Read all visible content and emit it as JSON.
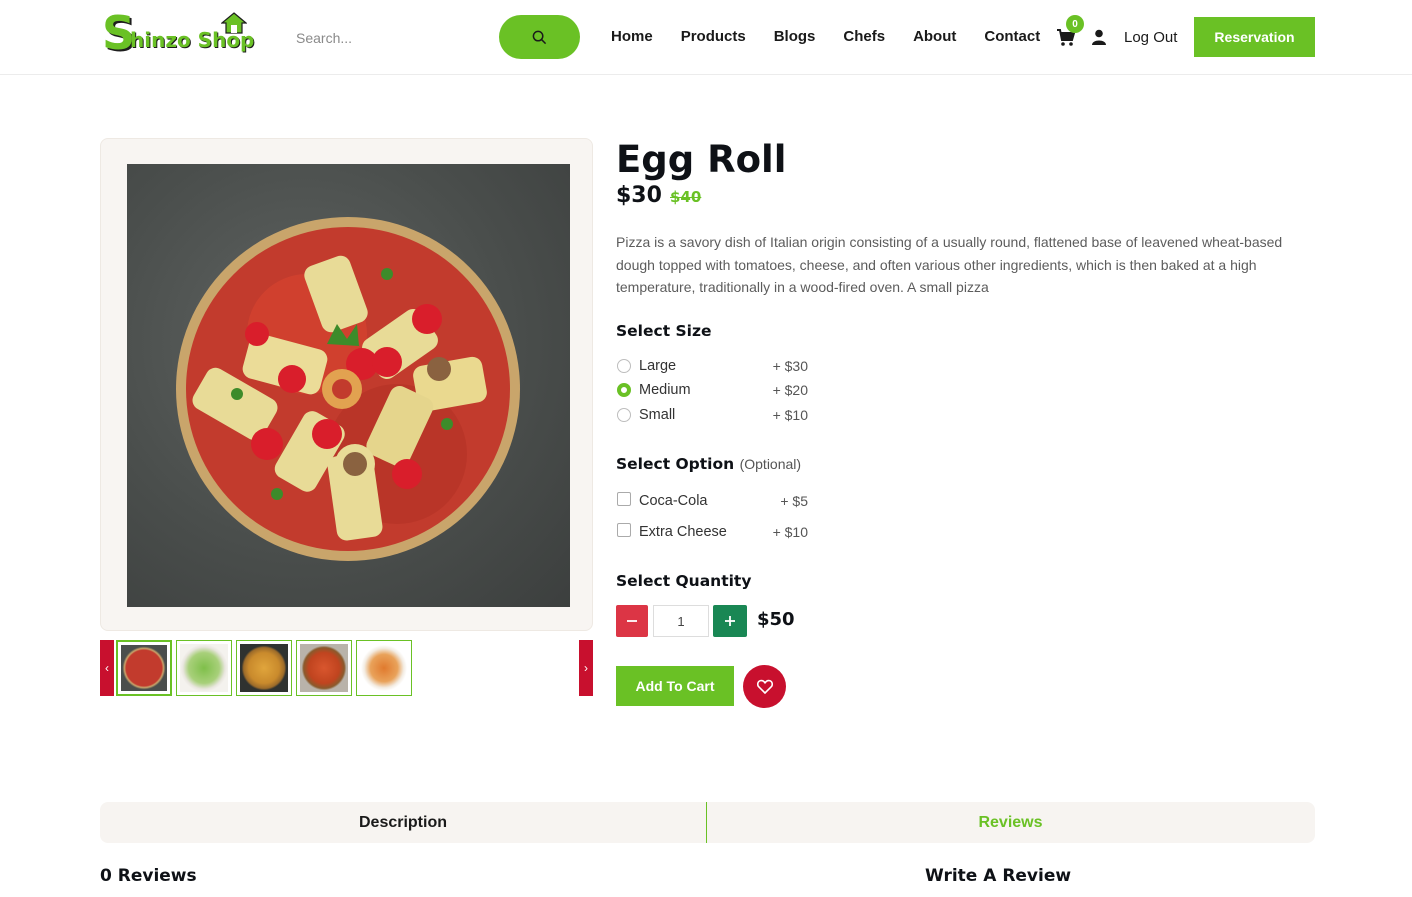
{
  "header": {
    "logo_text": "Shinzo Shop",
    "search_placeholder": "Search...",
    "nav": [
      "Home",
      "Products",
      "Blogs",
      "Chefs",
      "About",
      "Contact"
    ],
    "cart_count": "0",
    "logout_label": "Log Out",
    "reservation_label": "Reservation"
  },
  "product": {
    "title": "Egg Roll",
    "price": "$30",
    "old_price": "$40",
    "description": "Pizza is a savory dish of Italian origin consisting of a usually round, flattened base of leavened wheat-based dough topped with tomatoes, cheese, and often various other ingredients, which is then baked at a high temperature, traditionally in a wood-fired oven. A small pizza",
    "thumbnails": 5
  },
  "size": {
    "title": "Select Size",
    "options": [
      {
        "label": "Large",
        "price": "+ $30",
        "selected": false
      },
      {
        "label": "Medium",
        "price": "+ $20",
        "selected": true
      },
      {
        "label": "Small",
        "price": "+ $10",
        "selected": false
      }
    ]
  },
  "option": {
    "title": "Select Option",
    "optional": "(Optional)",
    "items": [
      {
        "label": "Coca-Cola",
        "price": "+ $5"
      },
      {
        "label": "Extra Cheese",
        "price": "+ $10"
      }
    ]
  },
  "quantity": {
    "title": "Select Quantity",
    "value": "1",
    "total": "$50"
  },
  "actions": {
    "add_to_cart": "Add To Cart"
  },
  "tabs": {
    "description": "Description",
    "reviews": "Reviews"
  },
  "reviews": {
    "count_label": "0 Reviews",
    "write_label": "Write A Review"
  },
  "colors": {
    "accent": "#6ac125",
    "danger": "#dc3545",
    "success": "#198754",
    "wishlist": "#c8102e"
  }
}
